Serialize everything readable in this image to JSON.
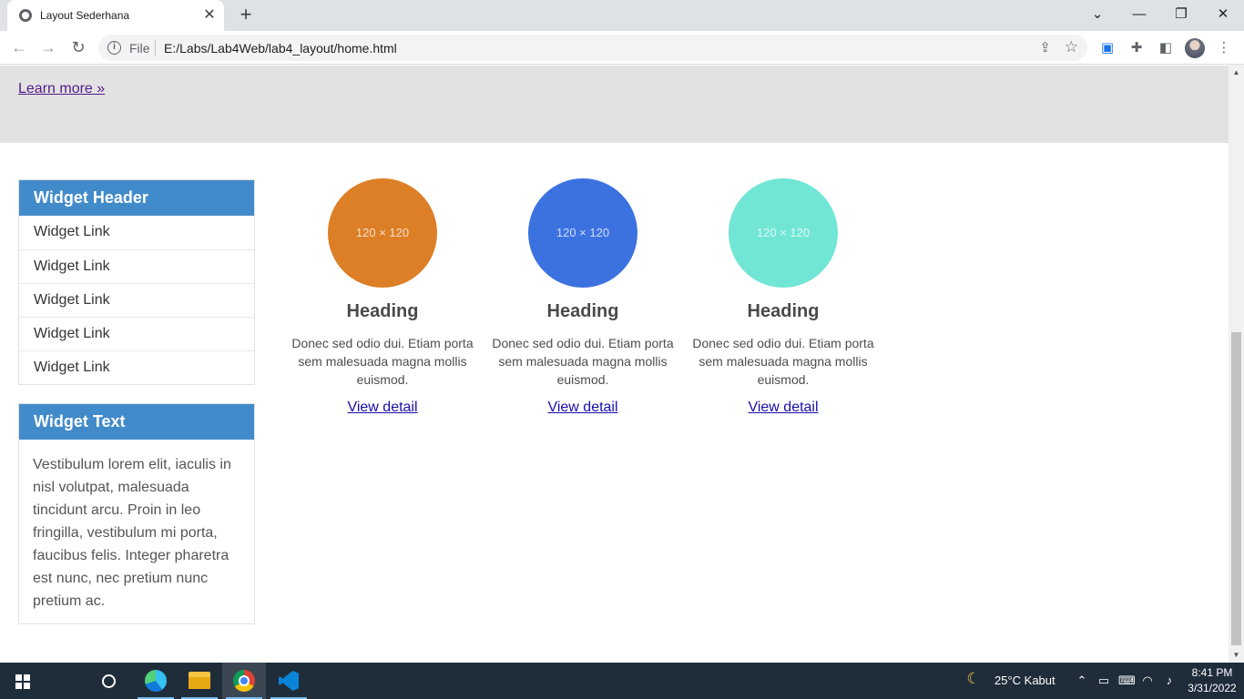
{
  "browser": {
    "tab_title": "Layout Sederhana",
    "tab_close": "✕",
    "new_tab": "+",
    "scheme_label": "File",
    "url": "E:/Labs/Lab4Web/lab4_layout/home.html",
    "window_controls": {
      "dropdown": "⌄",
      "minimize": "—",
      "restore": "❐",
      "close": "✕"
    }
  },
  "page": {
    "jumbotron": {
      "link": "Learn more »"
    },
    "sidebar": {
      "widget1": {
        "header": "Widget Header",
        "links": [
          "Widget Link",
          "Widget Link",
          "Widget Link",
          "Widget Link",
          "Widget Link"
        ]
      },
      "widget2": {
        "header": "Widget Text",
        "text": "Vestibulum lorem elit, iaculis in nisl volutpat, malesuada tincidunt arcu. Proin in leo fringilla, vestibulum mi porta, faucibus felis. Integer pharetra est nunc, nec pretium nunc pretium ac."
      }
    },
    "cards": [
      {
        "placeholder": "120 × 120",
        "color": "#dd7f26",
        "heading": "Heading",
        "text": "Donec sed odio dui. Etiam porta sem malesuada magna mollis euismod.",
        "link": "View detail"
      },
      {
        "placeholder": "120 × 120",
        "color": "#3c72e0",
        "heading": "Heading",
        "text": "Donec sed odio dui. Etiam porta sem malesuada magna mollis euismod.",
        "link": "View detail"
      },
      {
        "placeholder": "120 × 120",
        "color": "#72e6d5",
        "heading": "Heading",
        "text": "Donec sed odio dui. Etiam porta sem malesuada magna mollis euismod.",
        "link": "View detail"
      }
    ]
  },
  "taskbar": {
    "weather": "25°C  Kabut",
    "time": "8:41 PM",
    "date": "3/31/2022",
    "apps": [
      "start",
      "search",
      "task-view",
      "edge",
      "file-explorer",
      "chrome",
      "vscode"
    ]
  }
}
